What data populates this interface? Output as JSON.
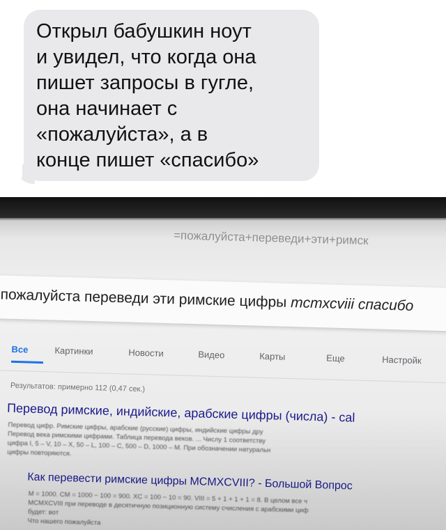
{
  "message": {
    "text": "Открыл бабушкин ноут\nи увидел, что когда она\nпишет запросы в гугле,\nона начинает с\n«пожалуйста», а в\nконце пишет «спасибо»"
  },
  "browser": {
    "address_bar": "=пожалуйста+переведи+эти+римск",
    "query_main": "пожалуйста переведи эти римские цифры ",
    "query_tail": "mcmxcviii спасибо"
  },
  "tabs": [
    {
      "label": "Все",
      "active": true
    },
    {
      "label": "Картинки"
    },
    {
      "label": "Новости"
    },
    {
      "label": "Видео"
    },
    {
      "label": "Карты"
    },
    {
      "label": "Еще"
    },
    {
      "label": "Настройк"
    }
  ],
  "results_stats": "Результатов: примерно 112 (0,47 сек.)",
  "results": [
    {
      "title": "Перевод римские, индийские, арабские цифры (числа) - cal",
      "snippet": [
        "Перевод цифр. Римские цифры, арабские (русские) цифры, индийские цифры дру",
        "Перевод века римскими цифрами. Таблица перевода веков. ... Числу 1 соответству",
        "цифра I, 5 – V, 10 – X, 50 – L, 100 – C, 500 – D, 1000 – M. При обозначении натуральн",
        "цифры повторяются."
      ]
    },
    {
      "title": "Как перевести римские цифры MCMXCVIII? - Большой Вопрос",
      "snippet": [
        "M = 1000. CM = 1000 − 100 = 900. XC = 100 − 10 = 90. VIII = 5 + 1 + 1 + 1 = 8. В целом все ч",
        "MCMXCVIII при переводе в десятичную позиционную систему счисления с арабскими циф",
        "будет: вот",
        "Что нашего пожалуйста"
      ]
    }
  ]
}
